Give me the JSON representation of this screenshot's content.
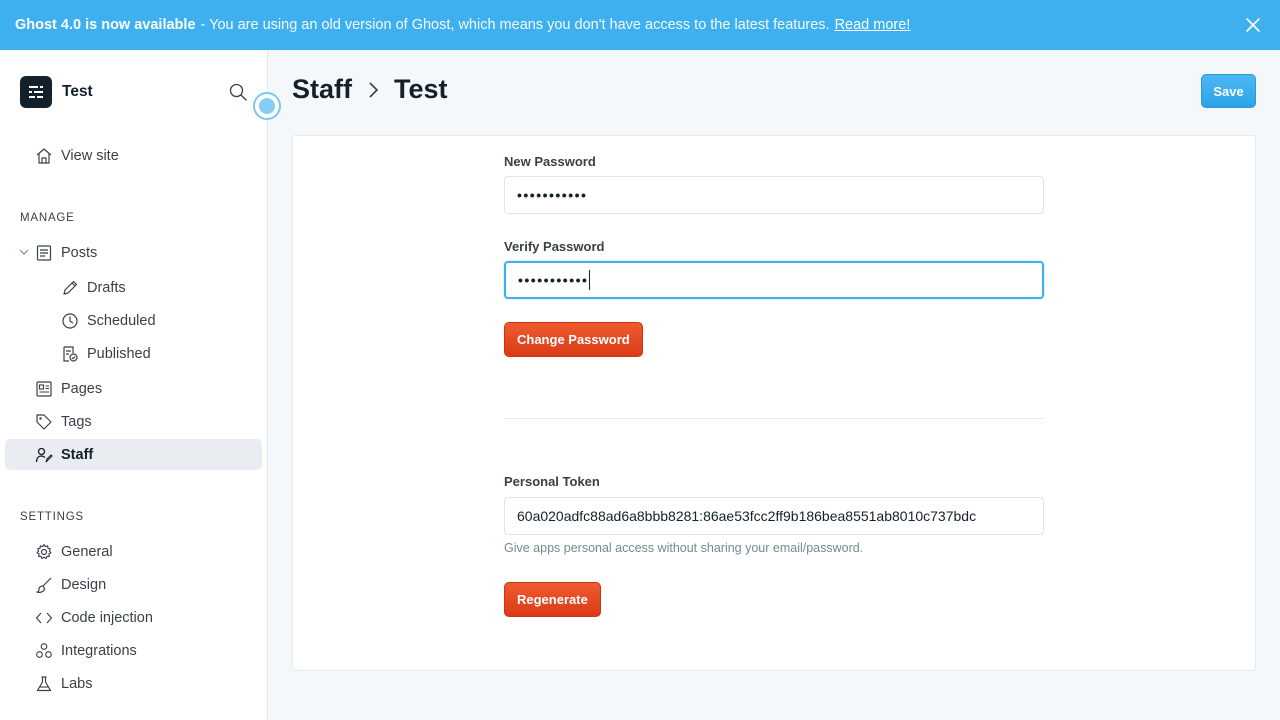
{
  "banner": {
    "title": "Ghost 4.0 is now available",
    "message": "- You are using an old version of Ghost, which means you don't have access to the latest features.",
    "link_label": "Read more!"
  },
  "sidebar": {
    "site_name": "Test",
    "view_site": "View site",
    "manage_label": "MANAGE",
    "settings_label": "SETTINGS",
    "manage_items": [
      {
        "label": "Posts",
        "icon": "posts-icon"
      },
      {
        "label": "Drafts",
        "icon": "pencil-icon"
      },
      {
        "label": "Scheduled",
        "icon": "clock-icon"
      },
      {
        "label": "Published",
        "icon": "published-icon"
      },
      {
        "label": "Pages",
        "icon": "pages-icon"
      },
      {
        "label": "Tags",
        "icon": "tag-icon"
      },
      {
        "label": "Staff",
        "icon": "staff-icon",
        "active": true
      }
    ],
    "settings_items": [
      {
        "label": "General",
        "icon": "gear-icon"
      },
      {
        "label": "Design",
        "icon": "brush-icon"
      },
      {
        "label": "Code injection",
        "icon": "code-icon"
      },
      {
        "label": "Integrations",
        "icon": "integrations-icon"
      },
      {
        "label": "Labs",
        "icon": "flask-icon"
      }
    ]
  },
  "header": {
    "breadcrumb_parent": "Staff",
    "breadcrumb_current": "Test",
    "save_label": "Save"
  },
  "form": {
    "new_password_label": "New Password",
    "new_password_value": "•••••••••••",
    "verify_password_label": "Verify Password",
    "verify_password_value": "•••••••••••",
    "change_password_label": "Change Password",
    "token_label": "Personal Token",
    "token_value": "60a020adfc88ad6a8bbb8281:86ae53fcc2ff9b186bea8551ab8010c737bdc",
    "token_help": "Give apps personal access without sharing your email/password.",
    "regenerate_label": "Regenerate"
  },
  "colors": {
    "banner": "#3eb0ef",
    "accent_blue": "#3eb0ef",
    "danger_red": "#e2441c",
    "sidebar_active": "#e9edf2"
  }
}
